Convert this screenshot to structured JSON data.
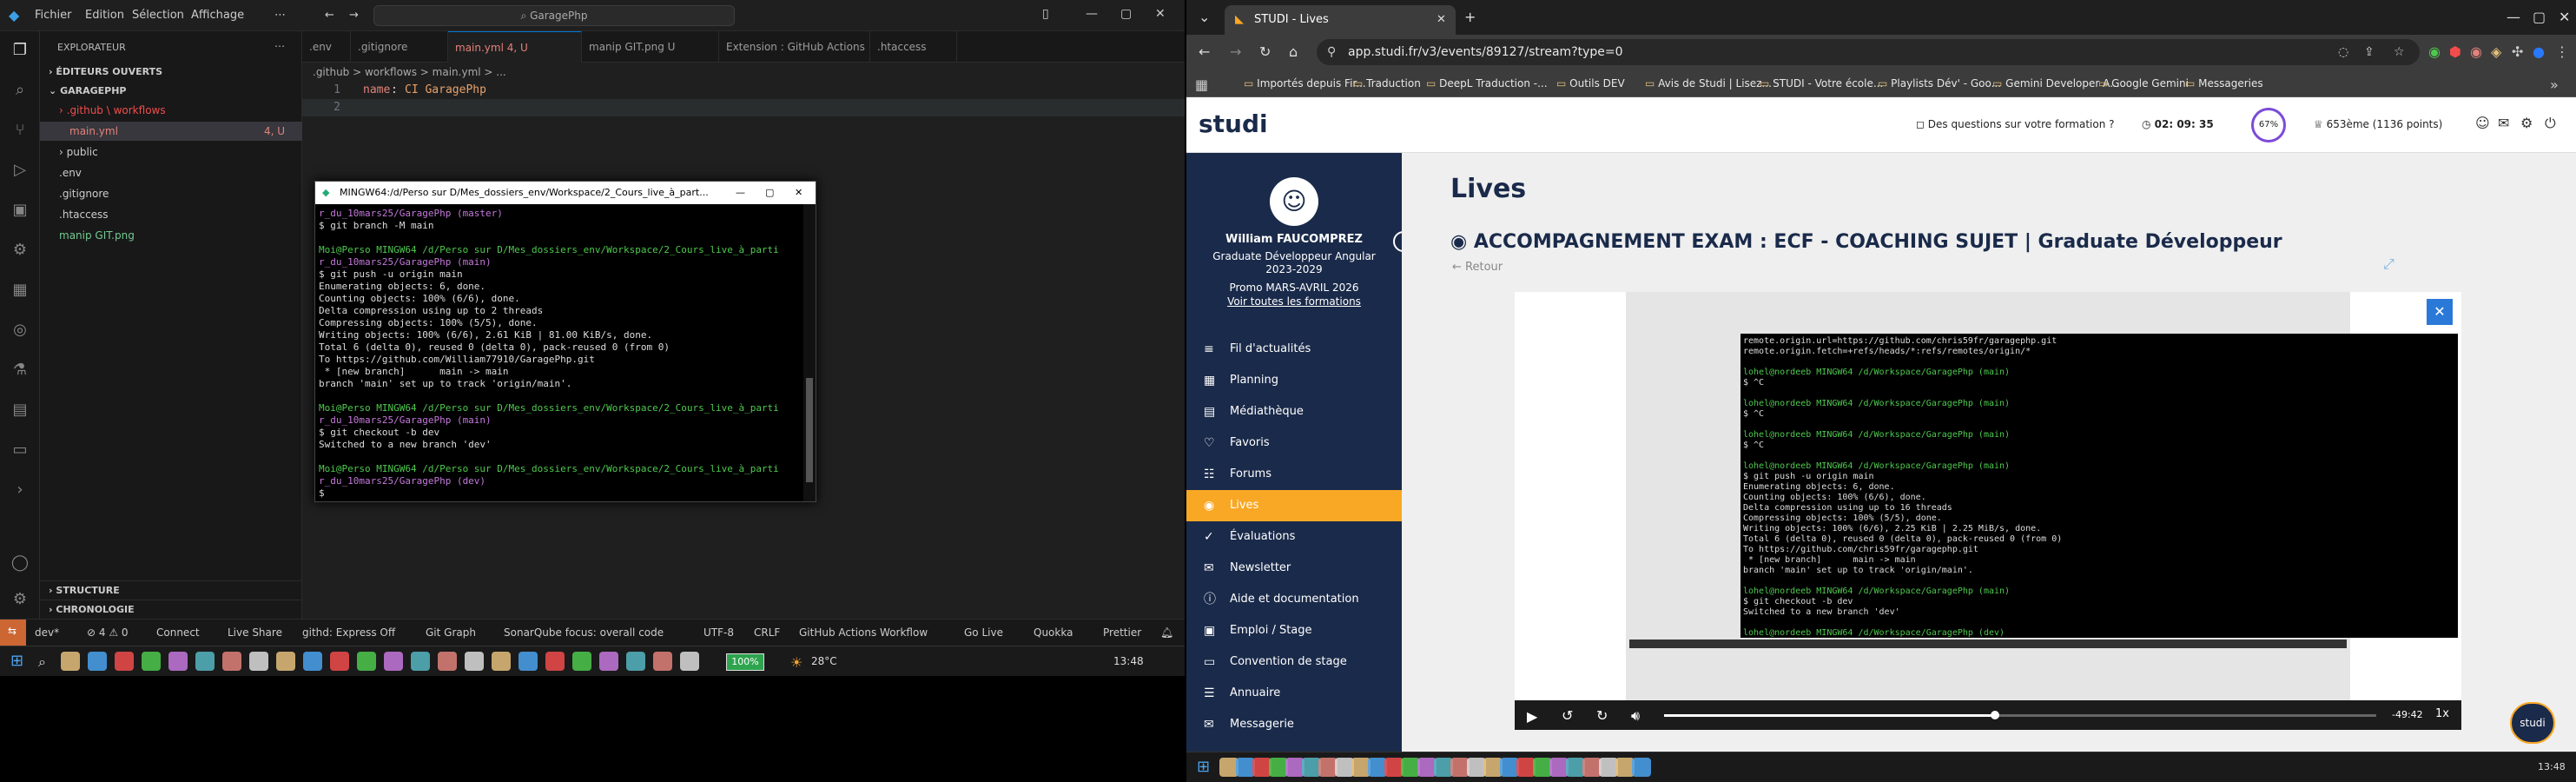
{
  "vscode": {
    "menu": [
      "Fichier",
      "Edition",
      "Sélection",
      "Affichage"
    ],
    "search_placeholder": "GaragePhp",
    "explorer_title": "EXPLORATEUR",
    "open_editors": "ÉDITEURS OUVERTS",
    "project": "GARAGEPHP",
    "tree": [
      {
        "label": ".github \\ workflows",
        "color": "#f14c4c",
        "indent": 1,
        "badge": ""
      },
      {
        "label": "main.yml",
        "color": "#e2827a",
        "indent": 2,
        "badge": "4, U"
      },
      {
        "label": "public",
        "color": "#ccc",
        "indent": 1,
        "badge": ""
      },
      {
        "label": ".env",
        "color": "#ccc",
        "indent": 1,
        "badge": ""
      },
      {
        "label": ".gitignore",
        "color": "#ccc",
        "indent": 1,
        "badge": ""
      },
      {
        "label": ".htaccess",
        "color": "#ccc",
        "indent": 1,
        "badge": ""
      },
      {
        "label": "manip GIT.png",
        "color": "#73c991",
        "indent": 1,
        "badge": ""
      }
    ],
    "structure": "STRUCTURE",
    "chronologie": "CHRONOLOGIE",
    "tabs": [
      {
        "label": ".env",
        "active": false
      },
      {
        "label": ".gitignore",
        "active": false
      },
      {
        "label": "main.yml 4, U",
        "active": true
      },
      {
        "label": "manip GIT.png U",
        "active": false
      },
      {
        "label": "Extension : GitHub Actions",
        "active": false
      },
      {
        "label": ".htaccess",
        "active": false
      }
    ],
    "breadcrumb": ".github > workflows > main.yml > ...",
    "code": [
      {
        "n": "1",
        "key": "name",
        "val": "CI GaragePhp"
      },
      {
        "n": "2",
        "key": "",
        "val": ""
      }
    ],
    "status": [
      "dev*",
      "⊘ 4 ⚠ 0",
      "Connect",
      "Live Share",
      "githd: Express Off",
      "Git Graph",
      "SonarQube focus: overall code",
      "UTF-8",
      "CRLF",
      "GitHub Actions Workflow",
      "Go Live",
      "Quokka",
      "Prettier"
    ]
  },
  "terminal": {
    "title": "MINGW64:/d/Perso sur D/Mes_dossiers_env/Workspace/2_Cours_live_à_part...",
    "lines": [
      {
        "t": "r_du_10mars25/GaragePhp (master)",
        "c": "purple"
      },
      {
        "t": "$ git branch -M main",
        "c": ""
      },
      {
        "t": "",
        "c": ""
      },
      {
        "t": "Moi@Perso MINGW64 /d/Perso sur D/Mes_dossiers_env/Workspace/2_Cours_live_à_parti",
        "c": "green"
      },
      {
        "t": "r_du_10mars25/GaragePhp (main)",
        "c": "purple"
      },
      {
        "t": "$ git push -u origin main",
        "c": ""
      },
      {
        "t": "Enumerating objects: 6, done.",
        "c": ""
      },
      {
        "t": "Counting objects: 100% (6/6), done.",
        "c": ""
      },
      {
        "t": "Delta compression using up to 2 threads",
        "c": ""
      },
      {
        "t": "Compressing objects: 100% (5/5), done.",
        "c": ""
      },
      {
        "t": "Writing objects: 100% (6/6), 2.61 KiB | 81.00 KiB/s, done.",
        "c": ""
      },
      {
        "t": "Total 6 (delta 0), reused 0 (delta 0), pack-reused 0 (from 0)",
        "c": ""
      },
      {
        "t": "To https://github.com/William77910/GaragePhp.git",
        "c": ""
      },
      {
        "t": " * [new branch]      main -> main",
        "c": ""
      },
      {
        "t": "branch 'main' set up to track 'origin/main'.",
        "c": ""
      },
      {
        "t": "",
        "c": ""
      },
      {
        "t": "Moi@Perso MINGW64 /d/Perso sur D/Mes_dossiers_env/Workspace/2_Cours_live_à_parti",
        "c": "green"
      },
      {
        "t": "r_du_10mars25/GaragePhp (main)",
        "c": "purple"
      },
      {
        "t": "$ git checkout -b dev",
        "c": ""
      },
      {
        "t": "Switched to a new branch 'dev'",
        "c": ""
      },
      {
        "t": "",
        "c": ""
      },
      {
        "t": "Moi@Perso MINGW64 /d/Perso sur D/Mes_dossiers_env/Workspace/2_Cours_live_à_parti",
        "c": "green"
      },
      {
        "t": "r_du_10mars25/GaragePhp (dev)",
        "c": "purple"
      },
      {
        "t": "$",
        "c": ""
      }
    ]
  },
  "chrome": {
    "tab_title": "STUDI - Lives",
    "url": "app.studi.fr/v3/events/89127/stream?type=0",
    "bookmarks": [
      "Importés depuis Fir...",
      "Traduction",
      "DeepL Traduction -...",
      "Outils DEV",
      "Avis de Studi | Lisez...",
      "STUDI - Votre école...",
      "Playlists Dév' - Goo...",
      "Gemini Developer A...",
      "Google Gemini",
      "Messageries"
    ]
  },
  "studi": {
    "logo": "studi",
    "question": "Des questions sur votre formation ?",
    "timer": "02: 09: 35",
    "progress": "67%",
    "ranking": "653ème (1136 points)",
    "user_name": "William FAUCOMPREZ",
    "program": "Graduate Développeur Angular 2023-2029",
    "promo": "Promo MARS-AVRIL 2026",
    "all_programs": "Voir toutes les formations",
    "nav": [
      {
        "label": "Fil d'actualités",
        "icon": "≡"
      },
      {
        "label": "Planning",
        "icon": "▦"
      },
      {
        "label": "Médiathèque",
        "icon": "▤"
      },
      {
        "label": "Favoris",
        "icon": "♡"
      },
      {
        "label": "Forums",
        "icon": "☷"
      },
      {
        "label": "Lives",
        "icon": "◉"
      },
      {
        "label": "Évaluations",
        "icon": "✓"
      },
      {
        "label": "Newsletter",
        "icon": "✉"
      },
      {
        "label": "Aide et documentation",
        "icon": "ⓘ"
      },
      {
        "label": "Emploi / Stage",
        "icon": "▣"
      },
      {
        "label": "Convention de stage",
        "icon": "▭"
      },
      {
        "label": "Annuaire",
        "icon": "☰"
      },
      {
        "label": "Messagerie",
        "icon": "✉"
      }
    ],
    "active_nav": 5,
    "page_title": "Lives",
    "live_title": "ACCOMPAGNEMENT EXAM : ECF - COACHING SUJET | Graduate Développeur",
    "back": "Retour",
    "time_left": "-49:42",
    "speed": "1x",
    "video_lines": [
      {
        "t": "remote.origin.url=https://github.com/chris59fr/garagephp.git",
        "c": ""
      },
      {
        "t": "remote.origin.fetch=+refs/heads/*:refs/remotes/origin/*",
        "c": ""
      },
      {
        "t": "",
        "c": ""
      },
      {
        "t": "lohel@nordeeb MINGW64 /d/Workspace/GaragePhp (main)",
        "c": "green"
      },
      {
        "t": "$ ^C",
        "c": ""
      },
      {
        "t": "",
        "c": ""
      },
      {
        "t": "lohel@nordeeb MINGW64 /d/Workspace/GaragePhp (main)",
        "c": "green"
      },
      {
        "t": "$ ^C",
        "c": ""
      },
      {
        "t": "",
        "c": ""
      },
      {
        "t": "lohel@nordeeb MINGW64 /d/Workspace/GaragePhp (main)",
        "c": "green"
      },
      {
        "t": "$ ^C",
        "c": ""
      },
      {
        "t": "",
        "c": ""
      },
      {
        "t": "lohel@nordeeb MINGW64 /d/Workspace/GaragePhp (main)",
        "c": "green"
      },
      {
        "t": "$ git push -u origin main",
        "c": ""
      },
      {
        "t": "Enumerating objects: 6, done.",
        "c": ""
      },
      {
        "t": "Counting objects: 100% (6/6), done.",
        "c": ""
      },
      {
        "t": "Delta compression using up to 16 threads",
        "c": ""
      },
      {
        "t": "Compressing objects: 100% (5/5), done.",
        "c": ""
      },
      {
        "t": "Writing objects: 100% (6/6), 2.25 KiB | 2.25 MiB/s, done.",
        "c": ""
      },
      {
        "t": "Total 6 (delta 0), reused 0 (delta 0), pack-reused 0 (from 0)",
        "c": ""
      },
      {
        "t": "To https://github.com/chris59fr/garagephp.git",
        "c": ""
      },
      {
        "t": " * [new branch]      main -> main",
        "c": ""
      },
      {
        "t": "branch 'main' set up to track 'origin/main'.",
        "c": ""
      },
      {
        "t": "",
        "c": ""
      },
      {
        "t": "lohel@nordeeb MINGW64 /d/Workspace/GaragePhp (main)",
        "c": "green"
      },
      {
        "t": "$ git checkout -b dev",
        "c": ""
      },
      {
        "t": "Switched to a new branch 'dev'",
        "c": ""
      },
      {
        "t": "",
        "c": ""
      },
      {
        "t": "lohel@nordeeb MINGW64 /d/Workspace/GaragePhp (dev)",
        "c": "green"
      },
      {
        "t": "$",
        "c": ""
      }
    ]
  },
  "taskbar_left": {
    "battery": "100%",
    "weather": "28°C",
    "clock": "13:48"
  },
  "taskbar_right": {
    "clock": "13:48"
  },
  "colors": {
    "studi_yellow": "#f9a825",
    "studi_navy": "#1a2a4a",
    "vscode_blue": "#0078d4"
  }
}
